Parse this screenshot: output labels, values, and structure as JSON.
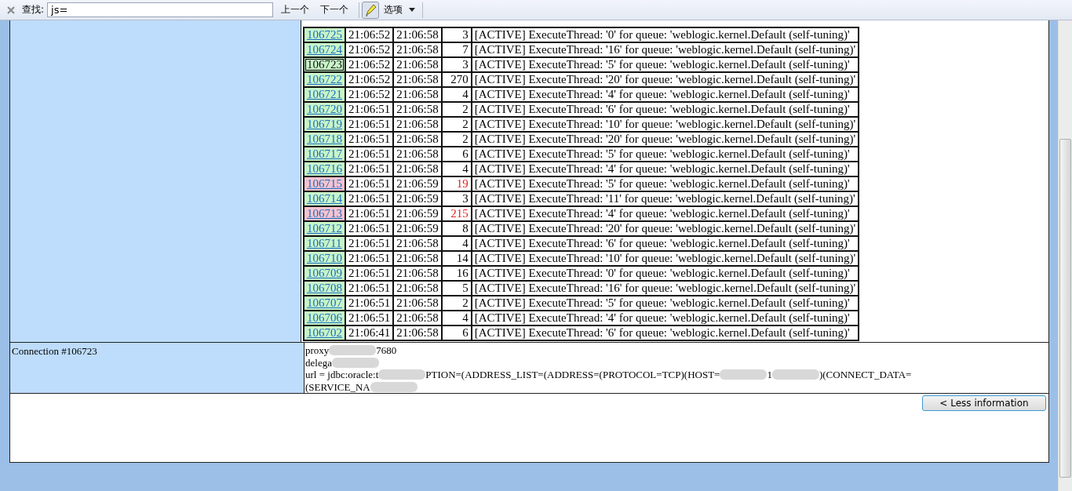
{
  "find_bar": {
    "label": "查找:",
    "value": "js=",
    "prev": "上一个",
    "next": "下一个",
    "options": "选项"
  },
  "threads": [
    {
      "id": "106725",
      "start": "21:06:52",
      "end": "21:06:58",
      "duration": "3",
      "slow": false,
      "selected": false,
      "description": "[ACTIVE] ExecuteThread: '0' for queue: 'weblogic.kernel.Default (self-tuning)'"
    },
    {
      "id": "106724",
      "start": "21:06:52",
      "end": "21:06:58",
      "duration": "7",
      "slow": false,
      "selected": false,
      "description": "[ACTIVE] ExecuteThread: '16' for queue: 'weblogic.kernel.Default (self-tuning)'"
    },
    {
      "id": "106723",
      "start": "21:06:52",
      "end": "21:06:58",
      "duration": "3",
      "slow": false,
      "selected": true,
      "description": "[ACTIVE] ExecuteThread: '5' for queue: 'weblogic.kernel.Default (self-tuning)'"
    },
    {
      "id": "106722",
      "start": "21:06:52",
      "end": "21:06:58",
      "duration": "270",
      "slow": false,
      "selected": false,
      "description": "[ACTIVE] ExecuteThread: '20' for queue: 'weblogic.kernel.Default (self-tuning)'"
    },
    {
      "id": "106721",
      "start": "21:06:52",
      "end": "21:06:58",
      "duration": "4",
      "slow": false,
      "selected": false,
      "description": "[ACTIVE] ExecuteThread: '4' for queue: 'weblogic.kernel.Default (self-tuning)'"
    },
    {
      "id": "106720",
      "start": "21:06:51",
      "end": "21:06:58",
      "duration": "2",
      "slow": false,
      "selected": false,
      "description": "[ACTIVE] ExecuteThread: '6' for queue: 'weblogic.kernel.Default (self-tuning)'"
    },
    {
      "id": "106719",
      "start": "21:06:51",
      "end": "21:06:58",
      "duration": "2",
      "slow": false,
      "selected": false,
      "description": "[ACTIVE] ExecuteThread: '10' for queue: 'weblogic.kernel.Default (self-tuning)'"
    },
    {
      "id": "106718",
      "start": "21:06:51",
      "end": "21:06:58",
      "duration": "2",
      "slow": false,
      "selected": false,
      "description": "[ACTIVE] ExecuteThread: '20' for queue: 'weblogic.kernel.Default (self-tuning)'"
    },
    {
      "id": "106717",
      "start": "21:06:51",
      "end": "21:06:58",
      "duration": "6",
      "slow": false,
      "selected": false,
      "description": "[ACTIVE] ExecuteThread: '5' for queue: 'weblogic.kernel.Default (self-tuning)'"
    },
    {
      "id": "106716",
      "start": "21:06:51",
      "end": "21:06:58",
      "duration": "4",
      "slow": false,
      "selected": false,
      "description": "[ACTIVE] ExecuteThread: '4' for queue: 'weblogic.kernel.Default (self-tuning)'"
    },
    {
      "id": "106715",
      "start": "21:06:51",
      "end": "21:06:59",
      "duration": "19",
      "slow": true,
      "selected": false,
      "description": "[ACTIVE] ExecuteThread: '5' for queue: 'weblogic.kernel.Default (self-tuning)'"
    },
    {
      "id": "106714",
      "start": "21:06:51",
      "end": "21:06:59",
      "duration": "3",
      "slow": false,
      "selected": false,
      "description": "[ACTIVE] ExecuteThread: '11' for queue: 'weblogic.kernel.Default (self-tuning)'"
    },
    {
      "id": "106713",
      "start": "21:06:51",
      "end": "21:06:59",
      "duration": "215",
      "slow": true,
      "selected": false,
      "description": "[ACTIVE] ExecuteThread: '4' for queue: 'weblogic.kernel.Default (self-tuning)'"
    },
    {
      "id": "106712",
      "start": "21:06:51",
      "end": "21:06:59",
      "duration": "8",
      "slow": false,
      "selected": false,
      "description": "[ACTIVE] ExecuteThread: '20' for queue: 'weblogic.kernel.Default (self-tuning)'"
    },
    {
      "id": "106711",
      "start": "21:06:51",
      "end": "21:06:58",
      "duration": "4",
      "slow": false,
      "selected": false,
      "description": "[ACTIVE] ExecuteThread: '6' for queue: 'weblogic.kernel.Default (self-tuning)'"
    },
    {
      "id": "106710",
      "start": "21:06:51",
      "end": "21:06:58",
      "duration": "14",
      "slow": false,
      "selected": false,
      "description": "[ACTIVE] ExecuteThread: '10' for queue: 'weblogic.kernel.Default (self-tuning)'"
    },
    {
      "id": "106709",
      "start": "21:06:51",
      "end": "21:06:58",
      "duration": "16",
      "slow": false,
      "selected": false,
      "description": "[ACTIVE] ExecuteThread: '0' for queue: 'weblogic.kernel.Default (self-tuning)'"
    },
    {
      "id": "106708",
      "start": "21:06:51",
      "end": "21:06:58",
      "duration": "5",
      "slow": false,
      "selected": false,
      "description": "[ACTIVE] ExecuteThread: '16' for queue: 'weblogic.kernel.Default (self-tuning)'"
    },
    {
      "id": "106707",
      "start": "21:06:51",
      "end": "21:06:58",
      "duration": "2",
      "slow": false,
      "selected": false,
      "description": "[ACTIVE] ExecuteThread: '5' for queue: 'weblogic.kernel.Default (self-tuning)'"
    },
    {
      "id": "106706",
      "start": "21:06:51",
      "end": "21:06:58",
      "duration": "4",
      "slow": false,
      "selected": false,
      "description": "[ACTIVE] ExecuteThread: '4' for queue: 'weblogic.kernel.Default (self-tuning)'"
    },
    {
      "id": "106702",
      "start": "21:06:41",
      "end": "21:06:58",
      "duration": "6",
      "slow": false,
      "selected": false,
      "description": "[ACTIVE] ExecuteThread: '6' for queue: 'weblogic.kernel.Default (self-tuning)'"
    }
  ],
  "connection": {
    "label": "Connection #106723",
    "lines": [
      [
        {
          "kind": "text",
          "text": "proxy"
        },
        {
          "kind": "redacted"
        },
        {
          "kind": "text",
          "text": "7680"
        }
      ],
      [
        {
          "kind": "text",
          "text": "delega"
        },
        {
          "kind": "redacted"
        }
      ],
      [
        {
          "kind": "text",
          "text": "url = jdbc:oracle:t"
        },
        {
          "kind": "redacted"
        },
        {
          "kind": "text",
          "text": "PTION=(ADDRESS_LIST=(ADDRESS=(PROTOCOL=TCP)(HOST="
        },
        {
          "kind": "redacted"
        },
        {
          "kind": "text",
          "text": "1"
        },
        {
          "kind": "redacted"
        },
        {
          "kind": "text",
          "text": ")(CONNECT_DATA="
        }
      ],
      [
        {
          "kind": "text",
          "text": "(SERVICE_NA"
        },
        {
          "kind": "redacted"
        }
      ]
    ]
  },
  "less_button": "< Less information"
}
